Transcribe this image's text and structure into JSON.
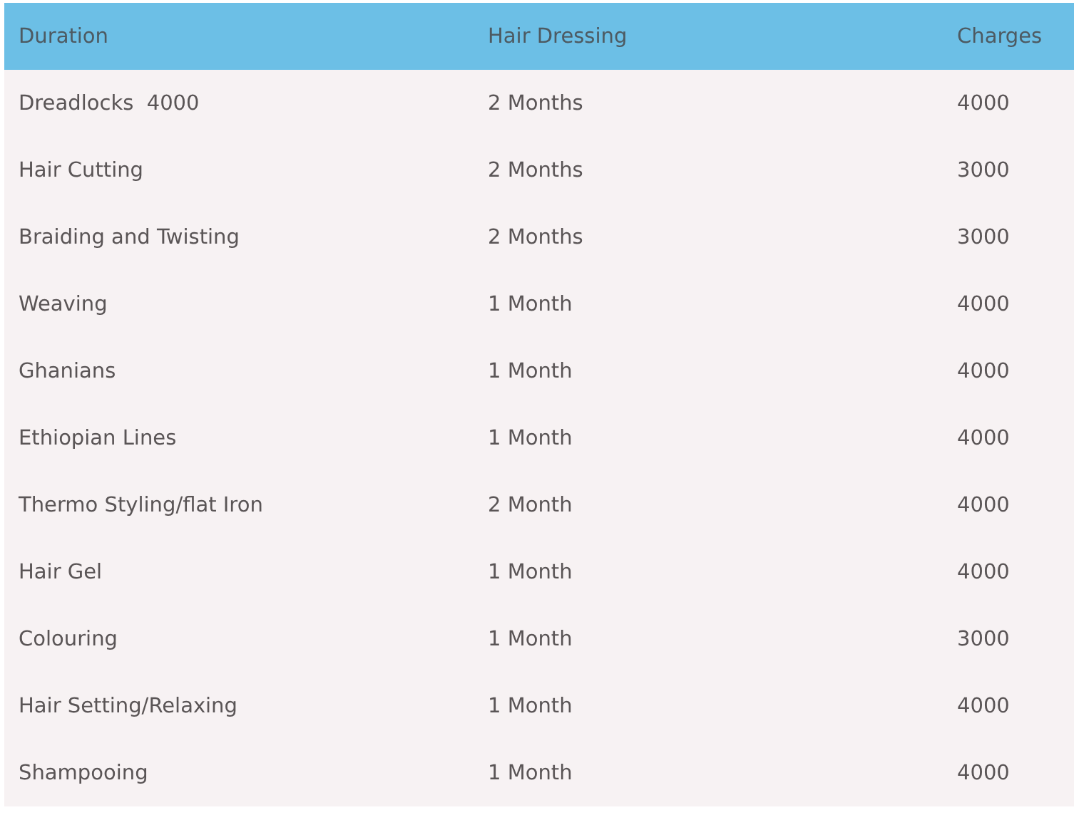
{
  "table": {
    "columns": [
      "Duration",
      "Hair Dressing",
      "Charges"
    ],
    "rows": [
      [
        "Dreadlocks  4000",
        "2 Months",
        "4000"
      ],
      [
        "Hair Cutting",
        "2 Months",
        "3000"
      ],
      [
        "Braiding and Twisting",
        "2 Months",
        "3000"
      ],
      [
        "Weaving",
        "1 Month",
        "4000"
      ],
      [
        "Ghanians",
        "1 Month",
        "4000"
      ],
      [
        "Ethiopian Lines",
        "1 Month",
        "4000"
      ],
      [
        "Thermo Styling/flat Iron",
        "2 Month",
        "4000"
      ],
      [
        "Hair Gel",
        "1 Month",
        "4000"
      ],
      [
        "Colouring",
        "1 Month",
        "3000"
      ],
      [
        "Hair Setting/Relaxing",
        "1 Month",
        "4000"
      ],
      [
        "Shampooing",
        "1 Month",
        "4000"
      ]
    ]
  }
}
